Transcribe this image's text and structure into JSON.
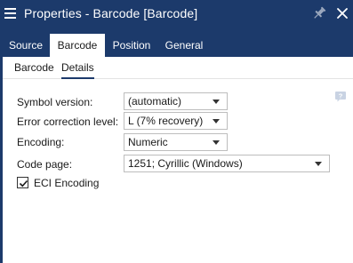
{
  "window": {
    "title": "Properties - Barcode [Barcode]",
    "menu_icon": "hamburger-menu-icon",
    "pin_icon": "pin-icon",
    "close_icon": "close-icon",
    "frame_color": "#1c3a6b"
  },
  "tabs": [
    {
      "label": "Source",
      "active": false
    },
    {
      "label": "Barcode",
      "active": true
    },
    {
      "label": "Position",
      "active": false
    },
    {
      "label": "General",
      "active": false
    }
  ],
  "subtabs": [
    {
      "label": "Barcode",
      "active": false
    },
    {
      "label": "Details",
      "active": true
    }
  ],
  "help_icon": "help-bubble-icon",
  "form": {
    "symbol_version": {
      "label": "Symbol version:",
      "value": "(automatic)"
    },
    "error_correction": {
      "label": "Error correction level:",
      "value": "L (7% recovery)"
    },
    "encoding": {
      "label": "Encoding:",
      "value": "Numeric"
    },
    "code_page": {
      "label": "Code page:",
      "value": "1251; Cyrillic (Windows)"
    },
    "eci_encoding": {
      "label": "ECI Encoding",
      "checked": true
    }
  }
}
